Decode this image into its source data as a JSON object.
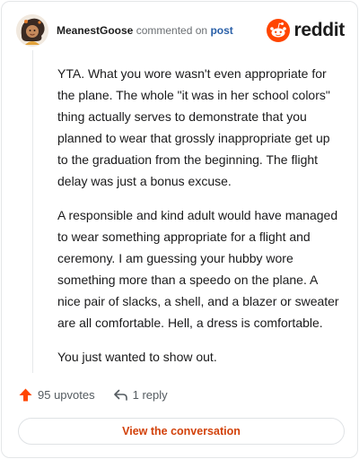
{
  "comment": {
    "username": "MeanestGoose",
    "commented_on": "commented on",
    "post_link": "post",
    "paragraphs": [
      "YTA. What you wore wasn't even appropriate for the plane. The whole \"it was in her school colors\" thing actually serves to demonstrate that you planned to wear that grossly inappropriate get up to the graduation from the beginning. The flight delay was just a bonus excuse.",
      "A responsible and kind adult would have managed to wear something appropriate for a flight and ceremony. I am guessing your hubby wore something more than a speedo on the plane. A nice pair of slacks, a shell, and a blazer or sweater are all comfortable. Hell, a dress is comfortable.",
      "You just wanted to show out."
    ]
  },
  "brand": {
    "name": "reddit",
    "icon": "reddit-logo-icon",
    "color": "#ff4500"
  },
  "actions": {
    "upvotes": "95 upvotes",
    "upvote_icon": "upvote-arrow-icon",
    "replies": "1 reply",
    "reply_icon": "reply-arrow-icon"
  },
  "button": {
    "label": "View the conversation"
  },
  "colors": {
    "accent": "#d2410a",
    "link": "#2a60a8",
    "upvote": "#ff4500"
  }
}
